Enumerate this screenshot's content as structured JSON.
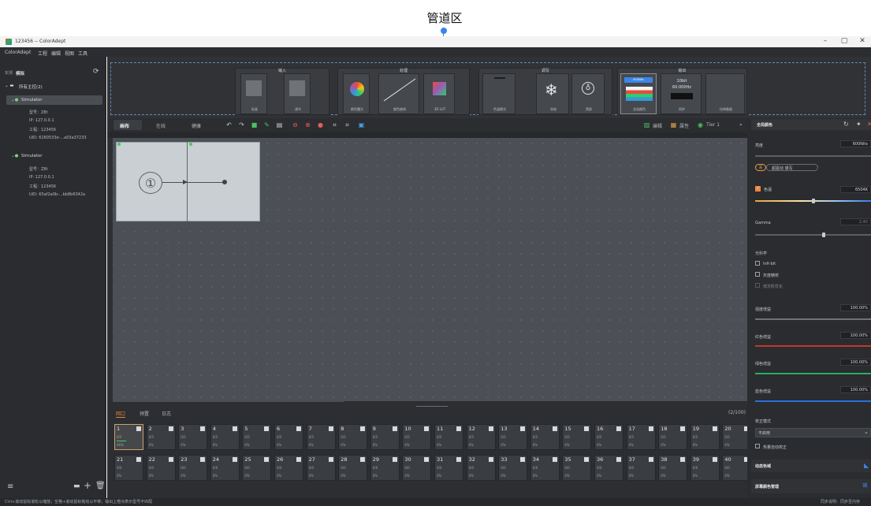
{
  "annotation": {
    "label": "管道区"
  },
  "window": {
    "title": "123456 -- ColorAdept",
    "minimize": "–",
    "maximize": "▢",
    "close": "✕"
  },
  "menu": {
    "items": [
      "ColorAdept",
      "工程",
      "编辑",
      "视图",
      "工具"
    ]
  },
  "left": {
    "tabs": [
      "实测",
      "模拟"
    ],
    "root": "所有主控(2)",
    "devices": [
      {
        "name": "Simulator",
        "model": "型号：Z8t",
        "ip": "IP: 127.0.0.1",
        "project": "工程：123456",
        "uid": "UID: 6260533e-...a03a37233"
      },
      {
        "name": "Simulator",
        "model": "型号：Z8t",
        "ip": "IP: 127.0.0.1",
        "project": "工程：123456",
        "uid": "UID: 65af2a0b-...bb8b6342a"
      }
    ]
  },
  "pipeline": {
    "groups": [
      {
        "title": "输入",
        "cards": [
          "标准",
          "清节"
        ]
      },
      {
        "title": "处理",
        "cards": [
          "颜色魔方",
          "颜色曲线",
          "3D LUT"
        ]
      },
      {
        "title": "调写",
        "cards": [
          "色温模式",
          "冻结",
          "黑屏"
        ]
      },
      {
        "title": "输出",
        "cards": [
          "全局颜色",
          "同步",
          "拉伸备援"
        ]
      }
    ],
    "output_nits": "600Nits",
    "output_bits": "10bit",
    "output_hz": "60.000Hz"
  },
  "toolbar": {
    "tabs": [
      "画布",
      "在线",
      "健康"
    ],
    "right": [
      "编辑",
      "属性",
      "Tier 1"
    ],
    "more": "»"
  },
  "canvas": {
    "node_number": "①"
  },
  "bottom": {
    "tabs": [
      "网口",
      "预置",
      "日志"
    ],
    "count": "(2/100)",
    "slots": [
      {
        "n": "1",
        "a": "0/5",
        "b": "46%"
      },
      {
        "n": "2",
        "a": "0/5",
        "b": "0%"
      },
      {
        "n": "3",
        "a": "0/5",
        "b": "0%"
      },
      {
        "n": "4",
        "a": "0/5",
        "b": "0%"
      },
      {
        "n": "5",
        "a": "0/5",
        "b": "0%"
      },
      {
        "n": "6",
        "a": "0/5",
        "b": "0%"
      },
      {
        "n": "7",
        "a": "0/5",
        "b": "0%"
      },
      {
        "n": "8",
        "a": "0/5",
        "b": "0%"
      },
      {
        "n": "9",
        "a": "0/5",
        "b": "0%"
      },
      {
        "n": "10",
        "a": "0/5",
        "b": "0%"
      },
      {
        "n": "11",
        "a": "0/5",
        "b": "0%"
      },
      {
        "n": "12",
        "a": "0/5",
        "b": "0%"
      },
      {
        "n": "13",
        "a": "0/5",
        "b": "0%"
      },
      {
        "n": "14",
        "a": "0/5",
        "b": "0%"
      },
      {
        "n": "15",
        "a": "0/5",
        "b": "0%"
      },
      {
        "n": "16",
        "a": "0/5",
        "b": "0%"
      },
      {
        "n": "17",
        "a": "0/5",
        "b": "0%"
      },
      {
        "n": "18",
        "a": "0/5",
        "b": "0%"
      },
      {
        "n": "19",
        "a": "0/5",
        "b": "0%"
      },
      {
        "n": "20",
        "a": "0/5",
        "b": "0%"
      },
      {
        "n": "21",
        "a": "0/0",
        "b": "0%"
      },
      {
        "n": "22",
        "a": "0/0",
        "b": "0%"
      },
      {
        "n": "23",
        "a": "0/0",
        "b": "0%"
      },
      {
        "n": "24",
        "a": "0/0",
        "b": "0%"
      },
      {
        "n": "25",
        "a": "0/0",
        "b": "0%"
      },
      {
        "n": "26",
        "a": "0/0",
        "b": "0%"
      },
      {
        "n": "27",
        "a": "0/0",
        "b": "0%"
      },
      {
        "n": "28",
        "a": "0/0",
        "b": "0%"
      },
      {
        "n": "29",
        "a": "0/0",
        "b": "0%"
      },
      {
        "n": "30",
        "a": "0/0",
        "b": "0%"
      },
      {
        "n": "31",
        "a": "0/0",
        "b": "0%"
      },
      {
        "n": "32",
        "a": "0/0",
        "b": "0%"
      },
      {
        "n": "33",
        "a": "0/0",
        "b": "0%"
      },
      {
        "n": "34",
        "a": "0/0",
        "b": "0%"
      },
      {
        "n": "35",
        "a": "0/0",
        "b": "0%"
      },
      {
        "n": "36",
        "a": "0/0",
        "b": "0%"
      },
      {
        "n": "37",
        "a": "0/0",
        "b": "0%"
      },
      {
        "n": "38",
        "a": "0/0",
        "b": "0%"
      },
      {
        "n": "39",
        "a": "0/0",
        "b": "0%"
      },
      {
        "n": "40",
        "a": "0/0",
        "b": "0%"
      }
    ]
  },
  "right": {
    "title": "全局颜色",
    "brightness": {
      "label": "亮度",
      "value": "600Nits"
    },
    "toggle": {
      "state": "关",
      "label": "超驱动 爆写"
    },
    "cct": {
      "label": "色温",
      "value": "6504K"
    },
    "gamma": {
      "label": "Gamma",
      "value": "2.40"
    },
    "optics": {
      "title": "光科学",
      "options": [
        "Infi-bit",
        "灰度精校",
        "低灰阶优化"
      ]
    },
    "gains": [
      {
        "label": "强度增益",
        "value": "100.00%"
      },
      {
        "label": "红色增益",
        "value": "100.00%"
      },
      {
        "label": "绿色增益",
        "value": "100.00%"
      },
      {
        "label": "蓝色增益",
        "value": "100.00%"
      }
    ],
    "calib": {
      "label": "校正模式",
      "value": "不启用",
      "auto": "热量自动校正"
    },
    "dyn_gamut": "动态色域",
    "global_color_mgmt": "屏幕颜色管理"
  },
  "status": {
    "hint": "Ctrl+滚动鼠标滚轮以缩放；空格+滚动鼠标拖动以平移；输出上橙点表示型号不匹配",
    "sync": "同步说明：同步至内存"
  },
  "colors": {
    "accent": "#3a86e8",
    "node_dot": "#3ecf5a",
    "tab_active": "#e8853c"
  }
}
